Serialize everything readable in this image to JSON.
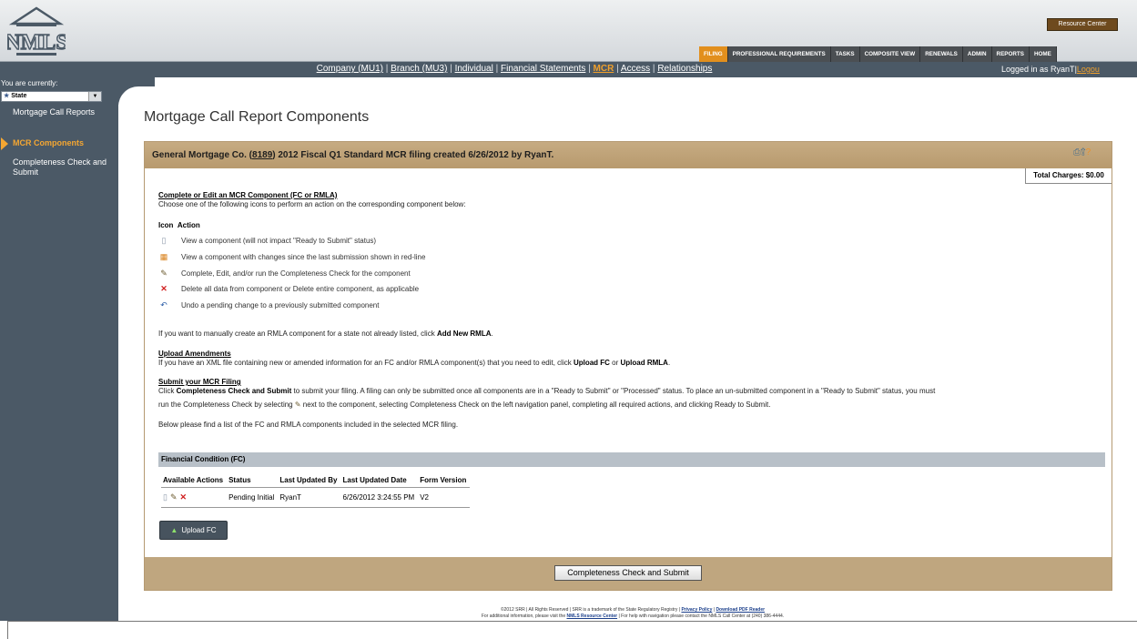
{
  "header": {
    "logo_text": "NMLS",
    "resource_center": "Resource Center",
    "tabs": [
      "FILING",
      "PROFESSIONAL REQUIREMENTS",
      "TASKS",
      "COMPOSITE VIEW",
      "RENEWALS",
      "ADMIN",
      "REPORTS",
      "HOME"
    ],
    "active_tab": "FILING"
  },
  "subnav": {
    "links": [
      "Company (MU1)",
      "Branch (MU3)",
      "Individual",
      "Financial Statements",
      "MCR",
      "Access",
      "Relationships"
    ],
    "active": "MCR",
    "separator": " | "
  },
  "user": {
    "logged_in_text": "Logged in as RyanT",
    "logout": "Logou"
  },
  "sidebar": {
    "currently_label": "You are currently:",
    "state_value": "State",
    "items": [
      {
        "label": "Mortgage Call Reports",
        "active": false
      },
      {
        "label": "MCR Components",
        "active": true
      },
      {
        "label": "Completeness Check and Submit",
        "active": false
      }
    ]
  },
  "main": {
    "page_title": "Mortgage Call Report Components",
    "panel_title_pre": "General Mortgage Co. (",
    "panel_title_num": "8189",
    "panel_title_post": ") 2012 Fiscal Q1 Standard MCR filing created 6/26/2012 by RyanT.",
    "total_charges": "Total Charges: $0.00",
    "complete_heading": "Complete or Edit an MCR Component (FC or RMLA)",
    "complete_text": "Choose one of the following icons to perform an action on the corresponding component below:",
    "icon_col": "Icon",
    "action_col": "Action",
    "actions": [
      {
        "icon": "document-icon",
        "text": "View a component (will not impact \"Ready to Submit\" status)"
      },
      {
        "icon": "redline-grid-icon",
        "text": "View a component with changes since the last submission shown in red-line"
      },
      {
        "icon": "edit-icon",
        "text": "Complete, Edit, and/or run the Completeness Check for the component"
      },
      {
        "icon": "delete-icon",
        "text": "Delete all data from component or Delete entire component, as applicable"
      },
      {
        "icon": "undo-icon",
        "text": "Undo a pending change to a previously submitted component"
      }
    ],
    "rmla_pre": "If you want to manually create an RMLA component for a state not already listed, click ",
    "rmla_bold": "Add New RMLA",
    "rmla_post": ".",
    "upload_heading": "Upload Amendments",
    "upload_pre": "If you have an XML file containing new or amended information for an FC and/or RMLA component(s) that you need to edit, click ",
    "upload_b1": "Upload FC",
    "upload_mid": " or ",
    "upload_b2": "Upload RMLA",
    "upload_post": ".",
    "submit_heading": "Submit your MCR Filing",
    "submit_line1_pre": "Click ",
    "submit_line1_bold": "Completeness Check and Submit",
    "submit_line1_post": " to submit your filing. A filing can only be submitted once all components are in a \"Ready to Submit\" or \"Processed\" status. To place an un-submitted component in a \"Ready to Submit\" status, you must",
    "submit_line2_pre": "run the Completeness Check by selecting ",
    "submit_line2_post": " next to the component, selecting Completeness Check on the left navigation panel, completing all required actions, and clicking Ready to Submit.",
    "list_text": "Below please find a list of the FC and RMLA components included in the selected MCR filing.",
    "fc_heading": "Financial Condition (FC)",
    "fc_columns": [
      "Available Actions",
      "Status",
      "Last Updated By",
      "Last Updated Date",
      "Form Version"
    ],
    "fc_rows": [
      {
        "status": "Pending Initial",
        "updated_by": "RyanT",
        "updated_date": "6/26/2012 3:24:55 PM",
        "version": "V2"
      }
    ],
    "upload_fc_button": "Upload FC",
    "cc_button": "Completeness Check and Submit"
  },
  "footer": {
    "line1_pre": "©2012 SRR | All Rights Reserved | SRR is a trademark of the State Regulatory Registry | ",
    "privacy": "Privacy Policy",
    "sep": " | ",
    "pdf": "Download PDF Reader",
    "line2_pre": "For additional information, please visit the ",
    "nmls_rc": "NMLS Resource Center",
    "line2_post": " | For help with navigation please contact the NMLS Call Center at (240) 386-4444."
  }
}
